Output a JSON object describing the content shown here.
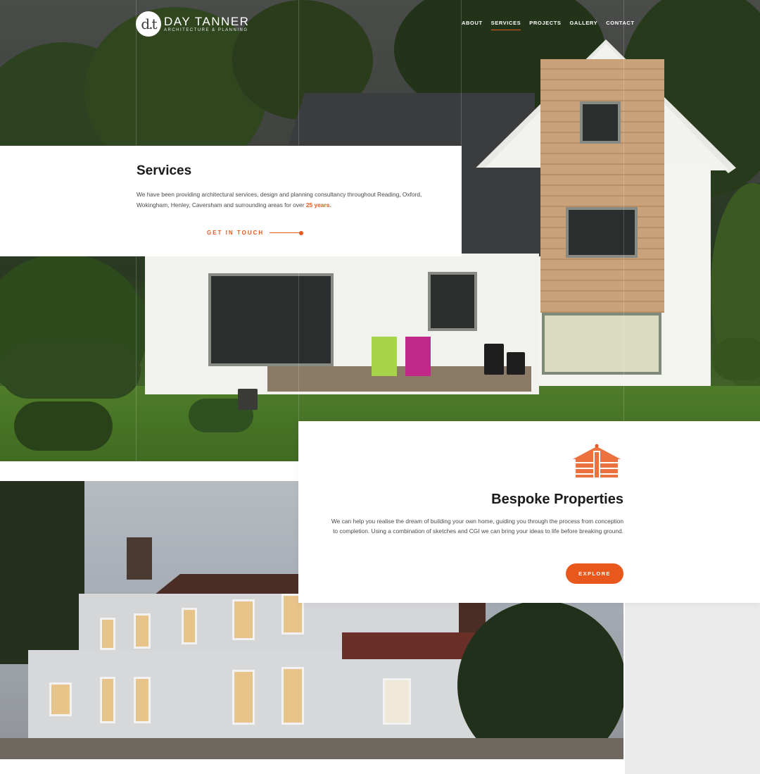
{
  "header": {
    "logo_mark": "d.t",
    "logo_name": "DAY TANNER",
    "logo_sub": "ARCHITECTURE & PLANNING"
  },
  "nav": {
    "items": [
      {
        "label": "ABOUT"
      },
      {
        "label": "SERVICES",
        "active": true
      },
      {
        "label": "PROJECTS"
      },
      {
        "label": "GALLERY"
      },
      {
        "label": "CONTACT"
      }
    ]
  },
  "services": {
    "title": "Services",
    "text_main": "We have been providing architectural services, design and planning consultancy throughout Reading, Oxford, Wokingham, Henley, Caversham and surrounding areas for over",
    "text_accent": "25 years.",
    "cta_label": "GET IN TOUCH"
  },
  "bespoke": {
    "icon": "house-icon",
    "title_bold": "Bespoke",
    "title_rest": "Properties",
    "text": "We can help you realise the dream of building your own home, guiding you through the process from conception to completion. Using a combination of sketches and CGI we can bring your ideas to life before breaking ground.",
    "button_label": "EXPLORE"
  },
  "colors": {
    "accent": "#e8581d",
    "text_dark": "#1a1a1a",
    "text_body": "#4a4a4a",
    "panel_grey": "#ebebeb"
  }
}
